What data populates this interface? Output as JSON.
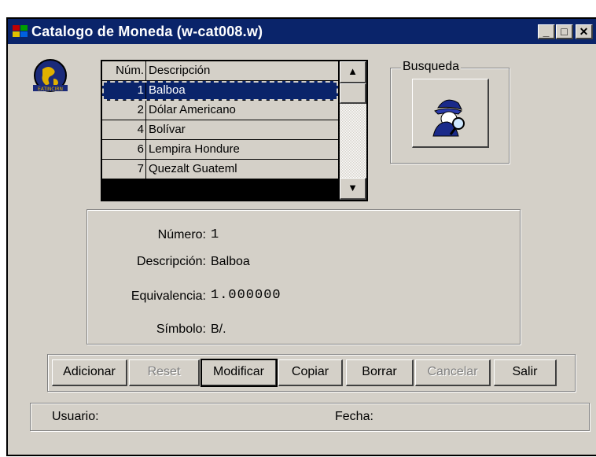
{
  "window": {
    "title": "Catalogo de Moneda (w-cat008.w)",
    "controls": {
      "minimize": "_",
      "maximize": "□",
      "close": "✕"
    }
  },
  "browse": {
    "columns": [
      "Núm.",
      "Descripción"
    ],
    "rows": [
      {
        "num": "1",
        "desc": "Balboa",
        "selected": true
      },
      {
        "num": "2",
        "desc": "Dólar Americano"
      },
      {
        "num": "4",
        "desc": "Bolívar"
      },
      {
        "num": "6",
        "desc": "Lempira Hondure"
      },
      {
        "num": "7",
        "desc": "Quezalt Guateml"
      }
    ],
    "scroll_up": "▲",
    "scroll_down": "▼"
  },
  "busqueda": {
    "label": "Busqueda",
    "icon": "detective-search-icon"
  },
  "form": {
    "numero_label": "Número:",
    "numero_value": "1",
    "descripcion_label": "Descripción:",
    "descripcion_value": "Balboa",
    "equivalencia_label": "Equivalencia:",
    "equivalencia_value": "1.000000",
    "simbolo_label": "Símbolo:",
    "simbolo_value": "B/."
  },
  "buttons": {
    "adicionar": "Adicionar",
    "reset": "Reset",
    "modificar": "Modificar",
    "copiar": "Copiar",
    "borrar": "Borrar",
    "cancelar": "Cancelar",
    "salir": "Salir"
  },
  "status": {
    "usuario_label": "Usuario:",
    "fecha_label": "Fecha:"
  },
  "colors": {
    "titlebar": "#0a246a",
    "face": "#d4d0c8",
    "selection": "#0a246a"
  }
}
